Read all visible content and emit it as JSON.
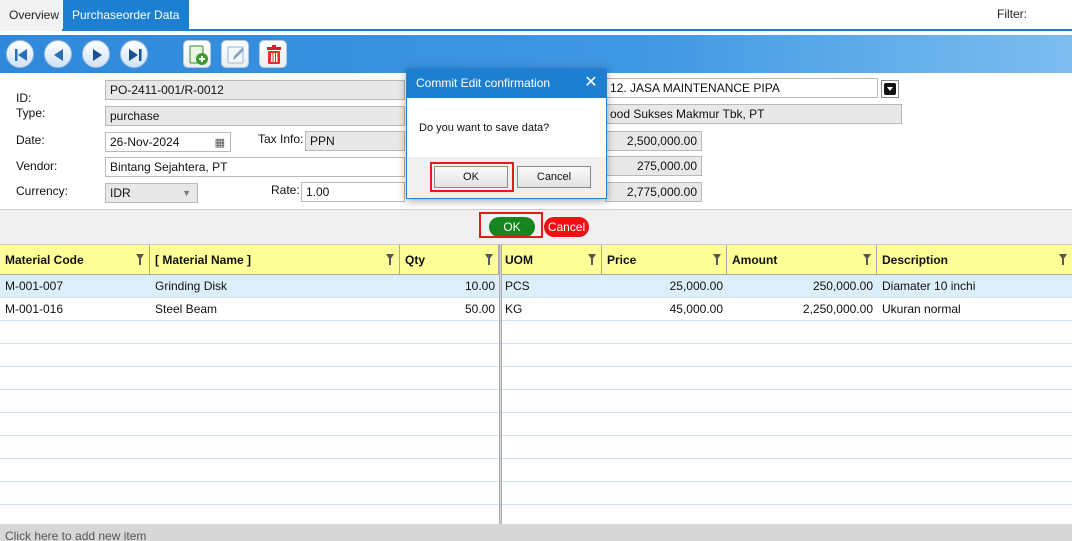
{
  "tabs": [
    {
      "label": "Overview",
      "active": false
    },
    {
      "label": "Purchaseorder Data",
      "active": true
    }
  ],
  "filter_label": "Filter:",
  "toolbar": {
    "icons": [
      "first-record-icon",
      "previous-record-icon",
      "next-record-icon",
      "last-record-icon",
      "add-record-icon",
      "edit-record-icon",
      "delete-record-icon"
    ]
  },
  "form": {
    "id_label": "ID:",
    "id_value": "PO-2411-001/R-0012",
    "type_label": "Type:",
    "type_value": "purchase",
    "date_label": "Date:",
    "date_value": "26-Nov-2024",
    "taxinfo_label": "Tax Info:",
    "taxinfo_value": "PPN",
    "vendor_label": "Vendor:",
    "vendor_value": "Bintang Sejahtera, PT",
    "currency_label": "Currency:",
    "currency_value": "IDR",
    "rate_label": "Rate:",
    "rate_value": "1.00",
    "project_value": "12. JASA MAINTENANCE PIPA",
    "company_value": "ood Sukses Makmur Tbk, PT",
    "subtotal_value": "2,500,000.00",
    "tax_value": "275,000.00",
    "total_value": "2,775,000.00"
  },
  "actions": {
    "ok_label": "OK",
    "cancel_label": "Cancel"
  },
  "grid": {
    "columns": [
      "Material Code",
      "[ Material Name ]",
      "Qty",
      "UOM",
      "Price",
      "Amount",
      "Description"
    ],
    "rows": [
      {
        "code": "M-001-007",
        "name": "Grinding Disk",
        "qty": "10.00",
        "uom": "PCS",
        "price": "25,000.00",
        "amount": "250,000.00",
        "description": "Diamater 10 inchi"
      },
      {
        "code": "M-001-016",
        "name": "Steel Beam",
        "qty": "50.00",
        "uom": "KG",
        "price": "45,000.00",
        "amount": "2,250,000.00",
        "description": "Ukuran normal"
      }
    ],
    "footer": "Click here to add new item"
  },
  "dialog": {
    "title": "Commit Edit confirmation",
    "message": "Do you want to save data?",
    "ok_label": "OK",
    "cancel_label": "Cancel"
  },
  "colors": {
    "accent": "#1c7fd1",
    "header_yellow": "#ffff99",
    "ok_green": "#17851d",
    "cancel_red": "#ee1111",
    "highlight_red": "#e21c1c"
  }
}
